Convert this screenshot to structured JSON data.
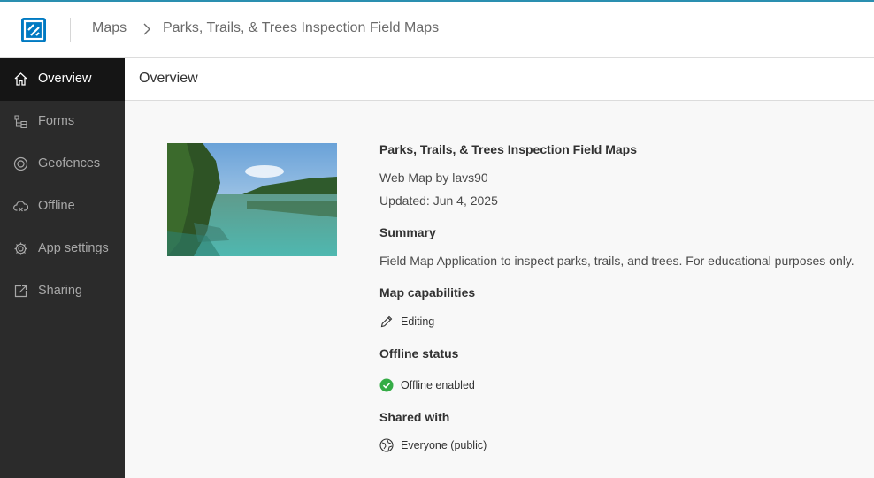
{
  "header": {
    "breadcrumb": {
      "maps": "Maps",
      "current": "Parks, Trails, & Trees Inspection Field Maps"
    }
  },
  "sidebar": {
    "items": [
      {
        "label": "Overview",
        "icon": "home-icon",
        "active": true
      },
      {
        "label": "Forms",
        "icon": "forms-icon",
        "active": false
      },
      {
        "label": "Geofences",
        "icon": "geofence-icon",
        "active": false
      },
      {
        "label": "Offline",
        "icon": "cloud-offline-icon",
        "active": false
      },
      {
        "label": "App settings",
        "icon": "gear-icon",
        "active": false
      },
      {
        "label": "Sharing",
        "icon": "share-icon",
        "active": false
      }
    ]
  },
  "main": {
    "section_title": "Overview",
    "map": {
      "title": "Parks, Trails, & Trees Inspection Field Maps",
      "subtitle": "Web Map by lavs90",
      "updated": "Updated: Jun 4, 2025"
    },
    "summary": {
      "heading": "Summary",
      "text": "Field Map Application to inspect parks, trails, and trees. For educational purposes only."
    },
    "capabilities": {
      "heading": "Map capabilities",
      "item": "Editing"
    },
    "offline": {
      "heading": "Offline status",
      "item": "Offline enabled"
    },
    "shared": {
      "heading": "Shared with",
      "item": "Everyone (public)"
    }
  },
  "colors": {
    "accent": "#007ac2",
    "sidebar_bg": "#2b2b2b",
    "sidebar_active": "#151515",
    "success": "#35ac46"
  }
}
